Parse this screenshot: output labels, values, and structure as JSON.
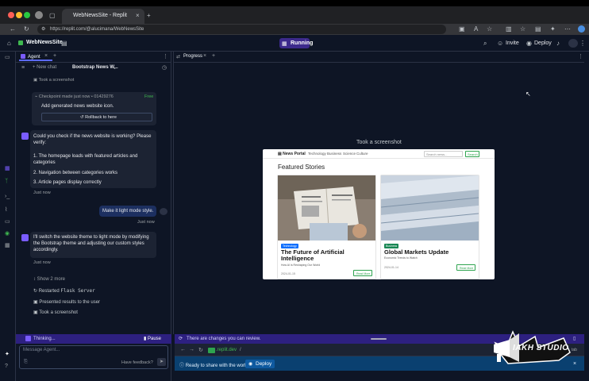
{
  "browser": {
    "tab_title": "WebNewsSite - Replit",
    "url": "https://replit.com/@alucimana/WebNewsSite"
  },
  "header": {
    "project_name": "WebNewsSite",
    "status": "Running",
    "invite_label": "Invite",
    "deploy_label": "Deploy"
  },
  "agent": {
    "tab_label": "Agent",
    "new_chat_label": "New chat",
    "chat_title": "Bootstrap News W...",
    "took_screenshot_top": "Took a screenshot",
    "checkpoint": {
      "prefix": "Checkpoint made",
      "when": "just now",
      "hash": "• 01429276",
      "free": "Free",
      "description": "Add generated news website icon.",
      "rollback": "Rollback to here"
    },
    "agent_msg_1": {
      "intro": "Could you check if the news website is working? Please verify:",
      "items": [
        "1. The homepage loads with featured articles and categories",
        "2. Navigation between categories works",
        "3. Article pages display correctly"
      ],
      "time": "Just now"
    },
    "user_msg": {
      "text": "Make it light mode style.",
      "time": "Just now"
    },
    "agent_msg_2": {
      "text": "I'll switch the website theme to light mode by modifying the Bootstrap theme and adjusting our custom styles accordingly.",
      "time": "Just now"
    },
    "actions": {
      "show_more": "Show 2 more",
      "restarted_prefix": "Restarted",
      "restarted_code": "Flask Server",
      "presented": "Presented results to the user",
      "took_screenshot": "Took a screenshot"
    },
    "thinking_label": "Thinking...",
    "pause_label": "Pause",
    "composer_placeholder": "Message Agent...",
    "feedback_label": "Have feedback?"
  },
  "progress": {
    "tab_label": "Progress",
    "took_screenshot": "Took a screenshot"
  },
  "preview": {
    "brand": "News Portal",
    "nav": [
      "Technology",
      "Business",
      "Science",
      "Culture"
    ],
    "search_placeholder": "Search news...",
    "search_button": "Search",
    "section_title": "Featured Stories",
    "cards": [
      {
        "category": "Technology",
        "category_color": "#0d6efd",
        "title": "The Future of Artificial Intelligence",
        "subtitle": "How AI is Reshaping Our World",
        "date": "2024-01-15",
        "button": "Read More"
      },
      {
        "category": "Business",
        "category_color": "#198754",
        "title": "Global Markets Update",
        "subtitle": "Economic Trends to Watch",
        "date": "2024-01-14",
        "button": "Read More"
      }
    ]
  },
  "bottom": {
    "changes_text": "There are changes you can review.",
    "web_url": ".replit.dev",
    "web_path": "/",
    "ready_text": "Ready to share with the world?",
    "deploy_label": "Deploy"
  },
  "watermark": {
    "text": "IAKH STUDIO"
  },
  "colors": {
    "accent": "#5b6aff",
    "running_bg": "#3c2a8c",
    "deploy_strip": "#0a4070"
  }
}
